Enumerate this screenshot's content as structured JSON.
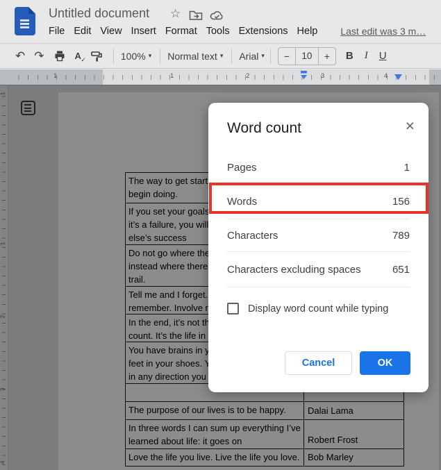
{
  "header": {
    "title": "Untitled document",
    "menu": [
      "File",
      "Edit",
      "View",
      "Insert",
      "Format",
      "Tools",
      "Extensions",
      "Help"
    ],
    "last_edit": "Last edit was 3 m…"
  },
  "icons": {
    "star": "☆",
    "undo": "↶",
    "redo": "↷",
    "caret_down": "▾",
    "close": "×",
    "spellcheck_letter": "A",
    "spellcheck_check": "✓"
  },
  "toolbar": {
    "zoom_level": "100%",
    "paragraph_style": "Normal text",
    "font_name": "Arial",
    "font_size": "10",
    "minus": "−",
    "plus": "+",
    "bold": "B",
    "italic": "I",
    "underline": "U"
  },
  "ruler": {
    "h_marks": [
      "1",
      "1",
      "2",
      "3",
      "4"
    ],
    "v_marks": [
      "1",
      "1",
      "2",
      "3",
      "4"
    ]
  },
  "document": {
    "table": {
      "rows": [
        {
          "lines": [
            "The way to get start",
            "begin doing."
          ],
          "author": ""
        },
        {
          "lines": [
            "If you set your goals",
            "it’s a failure, you will",
            "else’s success"
          ],
          "author": ""
        },
        {
          "lines": [
            "Do not go where the",
            "instead where there",
            "trail."
          ],
          "author": ""
        },
        {
          "lines": [
            "Tell me and I forget.",
            "remember. Involve m"
          ],
          "author": ""
        },
        {
          "lines": [
            "In the end, it’s not th",
            "count. It’s the life in y"
          ],
          "author": ""
        },
        {
          "lines": [
            "You have brains in y",
            "feet in your shoes. Y",
            "in any direction you"
          ],
          "author": ""
        },
        {
          "lines": [],
          "author": ""
        },
        {
          "lines": [
            "The purpose of our lives is to be happy."
          ],
          "author": "Dalai Lama"
        },
        {
          "lines": [
            "In three words I can sum up everything I’ve",
            "learned about life: it goes on"
          ],
          "author": "Robert Frost"
        },
        {
          "lines": [
            "Love the life you live. Live the life you love."
          ],
          "author": "Bob Marley"
        }
      ]
    }
  },
  "dialog": {
    "title": "Word count",
    "stats": [
      {
        "label": "Pages",
        "value": "1"
      },
      {
        "label": "Words",
        "value": "156",
        "highlighted": true
      },
      {
        "label": "Characters",
        "value": "789"
      },
      {
        "label": "Characters excluding spaces",
        "value": "651"
      }
    ],
    "checkbox_label": "Display word count while typing",
    "checkbox_checked": false,
    "cancel_label": "Cancel",
    "ok_label": "OK"
  },
  "colors": {
    "accent_blue": "#1a73e8",
    "highlight_red": "#e8322a"
  }
}
